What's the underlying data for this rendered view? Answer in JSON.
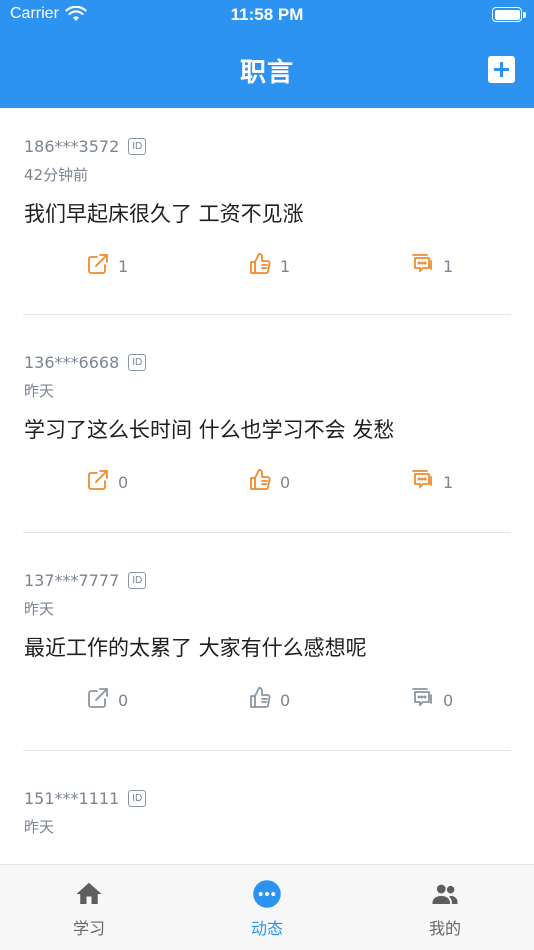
{
  "status_bar": {
    "carrier": "Carrier",
    "time": "11:58 PM"
  },
  "nav": {
    "title": "职言"
  },
  "posts": [
    {
      "phone": "186***3572",
      "badge": "ID",
      "time": "42分钟前",
      "content": "我们早起床很久了 工资不见涨",
      "shares": "1",
      "likes": "1",
      "comments": "1",
      "highlighted": true
    },
    {
      "phone": "136***6668",
      "badge": "ID",
      "time": "昨天",
      "content": "学习了这么长时间 什么也学习不会 发愁",
      "shares": "0",
      "likes": "0",
      "comments": "1",
      "highlighted": true
    },
    {
      "phone": "137***7777",
      "badge": "ID",
      "time": "昨天",
      "content": "最近工作的太累了 大家有什么感想呢",
      "shares": "0",
      "likes": "0",
      "comments": "0",
      "highlighted": false
    },
    {
      "phone": "151***1111",
      "badge": "ID",
      "time": "昨天",
      "content": "",
      "shares": "",
      "likes": "",
      "comments": "",
      "highlighted": false
    }
  ],
  "tabs": [
    {
      "label": "学习",
      "icon": "home-icon",
      "active": false
    },
    {
      "label": "动态",
      "icon": "more-circle-icon",
      "active": true
    },
    {
      "label": "我的",
      "icon": "people-icon",
      "active": false
    }
  ],
  "colors": {
    "primary": "#2d93f0",
    "accent_orange": "#f08a2c",
    "muted_gray": "#8a96a3"
  }
}
